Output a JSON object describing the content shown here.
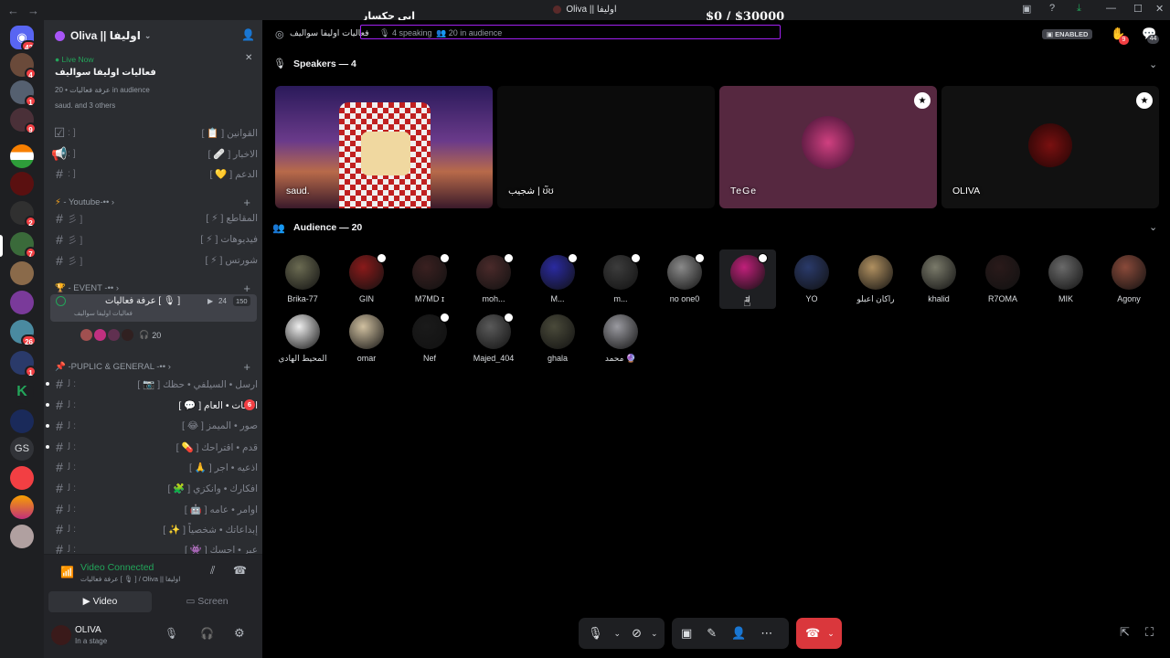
{
  "window": {
    "title": "Oliva || اوليفا",
    "overlay_name": "ابي جكسار",
    "overlay_money": "$0  / $30000"
  },
  "rail": {
    "dm_badge": "42",
    "badges": [
      "4",
      "1",
      "9",
      "2",
      "7",
      "1",
      "26",
      "1"
    ],
    "gs_label": "GS"
  },
  "guild": {
    "name": "Oliva || اوليفا"
  },
  "live": {
    "tag": "Live Now",
    "title": "فعاليات اوليفا سواليف",
    "meta": "عرفة فعاليات • 20 in audience",
    "people": "saud. and 3 others"
  },
  "channels": {
    "top": [
      {
        "name": "القوانين [ 📋 ]"
      },
      {
        "name": "الاخبار [ 🩹 ]"
      },
      {
        "name": "الدعم [ 💛 ]"
      }
    ],
    "cat_youtube": "- Youtube-••",
    "youtube": [
      {
        "name": "المقاطع [ ⚡ ]"
      },
      {
        "name": "فيديوهات [ ⚡ ]"
      },
      {
        "name": "شورتس [ ⚡ ]"
      }
    ],
    "cat_event": "- EVENT -••",
    "stage": {
      "name": "عرفة فعاليات [ 🎙 ]",
      "sub": "فعاليات اوليفا سواليف",
      "count1": "24",
      "count2": "150",
      "listeners": "20"
    },
    "cat_public": "-PUPLIC & GENERAL -••",
    "public": [
      {
        "name": "ارسل • السيلفي • حظك [ 📷 ]"
      },
      {
        "name": "الشات • العام [ 💬 ]",
        "badge": "6"
      },
      {
        "name": "صور • الميمز [ 😂 ]"
      },
      {
        "name": "قدم • اقتراحك [ 💊 ]"
      },
      {
        "name": "اذعيه • اجر [ 🙏 ]"
      },
      {
        "name": "افكارك • وانكزي [ 🧩 ]"
      },
      {
        "name": "اوامر • عامه [ 🤖 ]"
      },
      {
        "name": "إبداعاتك • شخصياً [ ✨ ]"
      },
      {
        "name": "عبر • احسك [ 👾 ]"
      }
    ]
  },
  "voice": {
    "status": "Video Connected",
    "where": "عرفة فعاليات [ 🎙 ] / Oliva || اوليفا",
    "video": "Video",
    "screen": "Screen"
  },
  "user": {
    "name": "OLIVA",
    "status": "In a stage"
  },
  "header": {
    "channel": "فعاليات اوليفا سواليف",
    "speaking": "4 speaking",
    "audience": "20 in audience",
    "enabled": "ENABLED",
    "hand_badge": "9",
    "inbox_badge": "44"
  },
  "speakers": {
    "heading": "Speakers — 4",
    "tiles": [
      {
        "name": "saud."
      },
      {
        "name": "شجيب | ʊ̃ʊ"
      },
      {
        "name": "TeGe"
      },
      {
        "name": "OLIVA"
      }
    ]
  },
  "audience": {
    "heading": "Audience — 20",
    "members": [
      {
        "name": "Brika-77",
        "color": "#6b6b52",
        "muted": false
      },
      {
        "name": "GIN",
        "color": "#8a1a1a",
        "muted": true
      },
      {
        "name": "M7MD ɪ",
        "color": "#3a2020",
        "muted": true
      },
      {
        "name": "moh...",
        "color": "#4a2a2a",
        "muted": true
      },
      {
        "name": "M...",
        "color": "#2a2aa0",
        "muted": true
      },
      {
        "name": "m...",
        "color": "#3c3c3c",
        "muted": true
      },
      {
        "name": "no one0",
        "color": "#8a8a8a",
        "muted": true
      },
      {
        "name": "ɪl",
        "color": "#c0207a",
        "muted": true
      },
      {
        "name": "YO",
        "color": "#2a3a6a",
        "muted": false
      },
      {
        "name": "راكان اعبلو",
        "color": "#b09060",
        "muted": false
      },
      {
        "name": "khalid",
        "color": "#7a7a6a",
        "muted": false
      },
      {
        "name": "R7OMA",
        "color": "#2a1a1a",
        "muted": false
      },
      {
        "name": "MIK",
        "color": "#6a6a6a",
        "muted": false
      },
      {
        "name": "Agony",
        "color": "#8a4a3a",
        "muted": false
      },
      {
        "name": "المحيط الهادي",
        "color": "#eeeeee",
        "muted": false
      },
      {
        "name": "omar",
        "color": "#d0c0a0",
        "muted": false
      },
      {
        "name": "Nef",
        "color": "#1a1a1a",
        "muted": true
      },
      {
        "name": "Majed_404",
        "color": "#5a5a5a",
        "muted": true
      },
      {
        "name": "ghala",
        "color": "#4a4a3a",
        "muted": false
      },
      {
        "name": "محمد 🔮",
        "color": "#9a9aa0",
        "muted": false
      }
    ]
  }
}
